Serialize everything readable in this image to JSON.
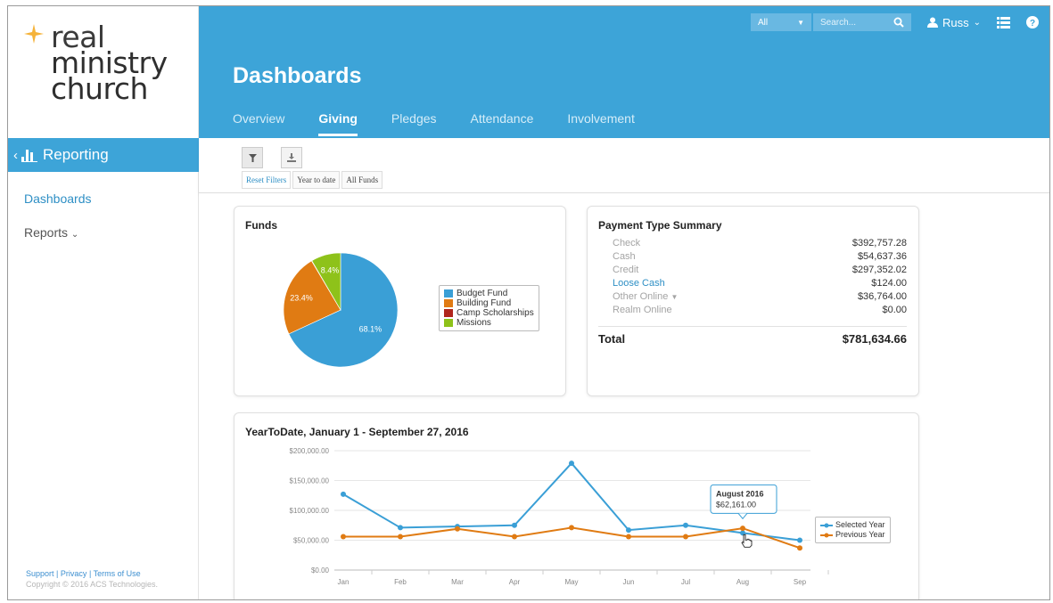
{
  "logo": {
    "line1": "real",
    "line2": "ministry",
    "line3": "church"
  },
  "sidebar": {
    "section_label": "Reporting",
    "items": [
      {
        "label": "Dashboards"
      },
      {
        "label": "Reports"
      }
    ],
    "footer": {
      "support": "Support",
      "privacy": "Privacy",
      "terms": "Terms of Use",
      "sep": "|",
      "copyright": "Copyright © 2016 ACS Technologies."
    }
  },
  "header": {
    "title": "Dashboards",
    "scope_value": "All",
    "search_placeholder": "Search...",
    "user_name": "Russ",
    "tabs": [
      {
        "label": "Overview"
      },
      {
        "label": "Giving"
      },
      {
        "label": "Pledges"
      },
      {
        "label": "Attendance"
      },
      {
        "label": "Involvement"
      }
    ],
    "active_tab": "Giving"
  },
  "toolbar": {
    "chips": [
      {
        "label": "Reset Filters"
      },
      {
        "label": "Year to date"
      },
      {
        "label": "All Funds"
      }
    ]
  },
  "funds_card": {
    "title": "Funds",
    "slices": [
      {
        "name": "Budget Fund",
        "percent": 68.1,
        "label": "68.1%",
        "color": "#3a9fd6"
      },
      {
        "name": "Building Fund",
        "percent": 23.4,
        "label": "23.4%",
        "color": "#e07b13"
      },
      {
        "name": "Camp Scholarships",
        "percent": 0.1,
        "label": "",
        "color": "#b0261c"
      },
      {
        "name": "Missions",
        "percent": 8.4,
        "label": "8.4%",
        "color": "#8ec21a"
      }
    ]
  },
  "payment_card": {
    "title": "Payment Type Summary",
    "rows": [
      {
        "label": "Check",
        "value": "$392,757.28"
      },
      {
        "label": "Cash",
        "value": "$54,637.36"
      },
      {
        "label": "Credit",
        "value": "$297,352.02"
      },
      {
        "label": "Loose Cash",
        "value": "$124.00"
      },
      {
        "label": "Other Online",
        "value": "$36,764.00"
      },
      {
        "label": "Realm Online",
        "value": "$0.00"
      }
    ],
    "total_label": "Total",
    "total_value": "$781,634.66"
  },
  "ytd_card": {
    "title": "YearToDate, January 1 - September 27, 2016",
    "tooltip": {
      "title": "August 2016",
      "value": "$62,161.00"
    }
  },
  "chart_data": {
    "type": "line",
    "categories": [
      "Jan",
      "Feb",
      "Mar",
      "Apr",
      "May",
      "Jun",
      "Jul",
      "Aug",
      "Sep"
    ],
    "yticks": [
      "$0.00",
      "$50,000.00",
      "$100,000.00",
      "$150,000.00",
      "$200,000.00"
    ],
    "ylim": [
      0,
      200000
    ],
    "legend_placement": "right",
    "series": [
      {
        "name": "Selected Year",
        "color": "#3a9fd6",
        "values": [
          127000,
          71000,
          73000,
          75000,
          179000,
          67000,
          75000,
          62161,
          50000
        ]
      },
      {
        "name": "Previous Year",
        "color": "#e07b13",
        "values": [
          56000,
          56000,
          69000,
          56000,
          71000,
          56000,
          56000,
          70000,
          37000
        ]
      }
    ]
  },
  "colors": {
    "brand": "#3da4d8",
    "link": "#2e8fc5",
    "star": "#f5b33a"
  }
}
